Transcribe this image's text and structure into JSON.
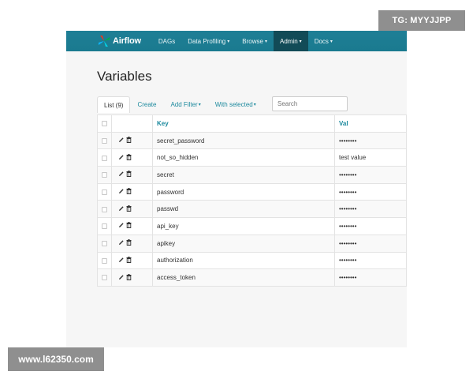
{
  "navbar": {
    "brand": "Airflow",
    "items": [
      {
        "label": "DAGs",
        "caret": ""
      },
      {
        "label": "Data Profiling",
        "caret": "▾"
      },
      {
        "label": "Browse",
        "caret": "▾"
      },
      {
        "label": "Admin",
        "caret": "▾"
      },
      {
        "label": "Docs",
        "caret": "▾"
      }
    ],
    "active_item": "Admin"
  },
  "page": {
    "title": "Variables"
  },
  "tabs": {
    "list": "List (9)",
    "create": "Create",
    "add_filter": "Add Filter",
    "with_selected": "With selected",
    "caret": "▾"
  },
  "search": {
    "placeholder": "Search"
  },
  "table": {
    "headers": {
      "key": "Key",
      "val": "Val"
    },
    "rows": [
      {
        "key": "secret_password",
        "val": "••••••••"
      },
      {
        "key": "not_so_hidden",
        "val": "test value"
      },
      {
        "key": "secret",
        "val": "••••••••"
      },
      {
        "key": "password",
        "val": "••••••••"
      },
      {
        "key": "passwd",
        "val": "••••••••"
      },
      {
        "key": "api_key",
        "val": "••••••••"
      },
      {
        "key": "apikey",
        "val": "••••••••"
      },
      {
        "key": "authorization",
        "val": "••••••••"
      },
      {
        "key": "access_token",
        "val": "••••••••"
      }
    ],
    "row_icons": [
      "pencil-icon",
      "trash-icon"
    ]
  },
  "watermarks": {
    "top_right": "TG: MYYJJPP",
    "bottom_left": "www.l62350.com"
  },
  "colors": {
    "navbar": "#1a7a8f",
    "navbar_active": "#124b57",
    "link": "#1d8a9e",
    "watermark": "#8f8f8f"
  }
}
